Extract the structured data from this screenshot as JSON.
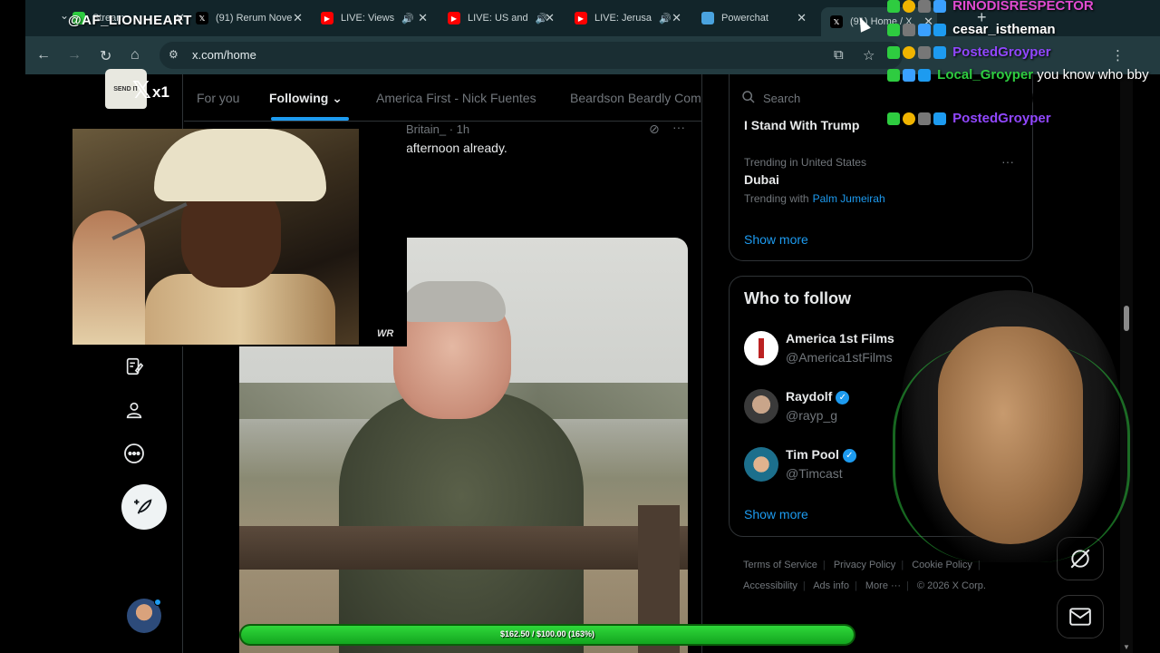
{
  "stream": {
    "username": "@AF_LIONHEART"
  },
  "browser": {
    "tabs": [
      {
        "label": "Stream",
        "favicon": "stream-favicon"
      },
      {
        "label": "(91) Rerum Nove",
        "favicon": "x-icon"
      },
      {
        "label": "LIVE: Views",
        "favicon": "youtube-icon"
      },
      {
        "label": "LIVE: US and",
        "favicon": "youtube-icon"
      },
      {
        "label": "LIVE: Jerusa",
        "favicon": "youtube-icon"
      },
      {
        "label": "Powerchat",
        "favicon": "powerchat-icon"
      },
      {
        "label": "(91) Home / X",
        "favicon": "x-icon"
      }
    ],
    "url": "x.com/home"
  },
  "x": {
    "logo_suffix": "x1",
    "shirt_text": "SEND IT",
    "feed_tabs": [
      {
        "label": "For you"
      },
      {
        "label": "Following"
      },
      {
        "label": "America First - Nick Fuentes"
      },
      {
        "label": "Beardson Beardly Com"
      }
    ],
    "tweet": {
      "meta": "Britain_ · 1h",
      "text": "afternoon already."
    },
    "video_watermark": "WR",
    "search": {
      "placeholder": "Search"
    },
    "trends": {
      "top_item": "I Stand With Trump",
      "context": "Trending in United States",
      "name": "Dubai",
      "with_label": "Trending with",
      "with_link": "Palm Jumeirah",
      "show_more": "Show more"
    },
    "who_to_follow": {
      "title": "Who to follow",
      "accounts": [
        {
          "name": "America 1st Films",
          "handle": "@America1stFilms",
          "verified": false
        },
        {
          "name": "Raydolf",
          "handle": "@rayp_g",
          "verified": true
        },
        {
          "name": "Tim Pool",
          "handle": "@Timcast",
          "verified": true
        }
      ],
      "show_more": "Show more"
    },
    "footer": {
      "terms": "Terms of Service",
      "privacy": "Privacy Policy",
      "cookie": "Cookie Policy",
      "accessibility": "Accessibility",
      "ads": "Ads info",
      "more": "More ···",
      "copyright": "© 2026 X Corp."
    }
  },
  "chat": [
    {
      "user": "RINODISRESPECTOR",
      "message": "",
      "color": "#e14bd2"
    },
    {
      "user": "cesar_istheman",
      "message": "",
      "color": "#ffffff"
    },
    {
      "user": "PostedGroyper",
      "message": "",
      "color": "#9147ff"
    },
    {
      "user": "Local_Groyper",
      "message": "you know who bby",
      "color": "#2ecc40"
    },
    {
      "user": "PostedGroyper",
      "message": "",
      "color": "#9147ff"
    }
  ],
  "donation_goal": {
    "text": "$162.50 / $100.00 (163%)",
    "progress": 1.0
  },
  "colors": {
    "accent": "#1d9bf0",
    "goal": "#2fd83a"
  }
}
